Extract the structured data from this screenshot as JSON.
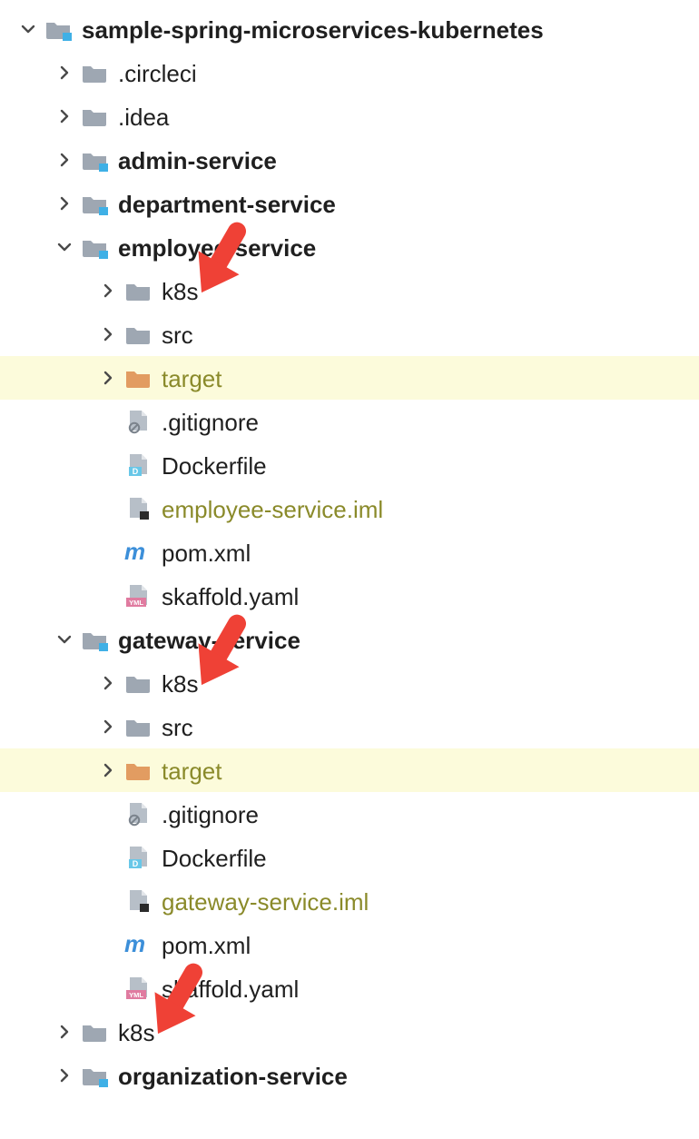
{
  "colors": {
    "folderGrey": "#9ea7b2",
    "folderOrange": "#e29c61",
    "cornerBlue": "#3fb0e6",
    "fileGrey": "#b7bfc8",
    "fileAccentD": "#68c7e8",
    "fileAccentYml": "#e07ba0",
    "mavenBlue": "#3c8fd9",
    "olive": "#8a8a2a",
    "hl": "#fcfbdb"
  },
  "rows": [
    {
      "level": 0,
      "toggle": "down",
      "icon": "module-folder",
      "label": "sample-spring-microservices-kubernetes",
      "bold": true,
      "olive": false,
      "hl": false
    },
    {
      "level": 1,
      "toggle": "right",
      "icon": "folder",
      "label": ".circleci",
      "bold": false,
      "olive": false,
      "hl": false
    },
    {
      "level": 1,
      "toggle": "right",
      "icon": "folder",
      "label": ".idea",
      "bold": false,
      "olive": false,
      "hl": false
    },
    {
      "level": 1,
      "toggle": "right",
      "icon": "module-folder",
      "label": "admin-service",
      "bold": true,
      "olive": false,
      "hl": false
    },
    {
      "level": 1,
      "toggle": "right",
      "icon": "module-folder",
      "label": "department-service",
      "bold": true,
      "olive": false,
      "hl": false
    },
    {
      "level": 1,
      "toggle": "down",
      "icon": "module-folder",
      "label": "employee-service",
      "bold": true,
      "olive": false,
      "hl": false,
      "arrow_to": true
    },
    {
      "level": 2,
      "toggle": "right",
      "icon": "folder",
      "label": "k8s",
      "bold": false,
      "olive": false,
      "hl": false
    },
    {
      "level": 2,
      "toggle": "right",
      "icon": "folder",
      "label": "src",
      "bold": false,
      "olive": false,
      "hl": false
    },
    {
      "level": 2,
      "toggle": "right",
      "icon": "folder-orange",
      "label": "target",
      "bold": false,
      "olive": true,
      "hl": true
    },
    {
      "level": 2,
      "toggle": "",
      "icon": "file-ignore",
      "label": ".gitignore",
      "bold": false,
      "olive": false,
      "hl": false
    },
    {
      "level": 2,
      "toggle": "",
      "icon": "file-d",
      "label": "Dockerfile",
      "bold": false,
      "olive": false,
      "hl": false
    },
    {
      "level": 2,
      "toggle": "",
      "icon": "file-iml",
      "label": "employee-service.iml",
      "bold": false,
      "olive": true,
      "hl": false
    },
    {
      "level": 2,
      "toggle": "",
      "icon": "maven",
      "label": "pom.xml",
      "bold": false,
      "olive": false,
      "hl": false
    },
    {
      "level": 2,
      "toggle": "",
      "icon": "file-yml",
      "label": "skaffold.yaml",
      "bold": false,
      "olive": false,
      "hl": false
    },
    {
      "level": 1,
      "toggle": "down",
      "icon": "module-folder",
      "label": "gateway-service",
      "bold": true,
      "olive": false,
      "hl": false,
      "arrow_to": true
    },
    {
      "level": 2,
      "toggle": "right",
      "icon": "folder",
      "label": "k8s",
      "bold": false,
      "olive": false,
      "hl": false
    },
    {
      "level": 2,
      "toggle": "right",
      "icon": "folder",
      "label": "src",
      "bold": false,
      "olive": false,
      "hl": false
    },
    {
      "level": 2,
      "toggle": "right",
      "icon": "folder-orange",
      "label": "target",
      "bold": false,
      "olive": true,
      "hl": true
    },
    {
      "level": 2,
      "toggle": "",
      "icon": "file-ignore",
      "label": ".gitignore",
      "bold": false,
      "olive": false,
      "hl": false
    },
    {
      "level": 2,
      "toggle": "",
      "icon": "file-d",
      "label": "Dockerfile",
      "bold": false,
      "olive": false,
      "hl": false
    },
    {
      "level": 2,
      "toggle": "",
      "icon": "file-iml",
      "label": "gateway-service.iml",
      "bold": false,
      "olive": true,
      "hl": false
    },
    {
      "level": 2,
      "toggle": "",
      "icon": "maven",
      "label": "pom.xml",
      "bold": false,
      "olive": false,
      "hl": false
    },
    {
      "level": 2,
      "toggle": "",
      "icon": "file-yml",
      "label": "skaffold.yaml",
      "bold": false,
      "olive": false,
      "hl": false,
      "arrow_below": true
    },
    {
      "level": 1,
      "toggle": "right",
      "icon": "folder",
      "label": "k8s",
      "bold": false,
      "olive": false,
      "hl": false
    },
    {
      "level": 1,
      "toggle": "right",
      "icon": "module-folder",
      "label": "organization-service",
      "bold": true,
      "olive": false,
      "hl": false
    }
  ],
  "arrows": [
    {
      "row": 6,
      "targetLevel": 2
    },
    {
      "row": 15,
      "targetLevel": 2
    },
    {
      "row": 23,
      "targetLevel": 1
    }
  ]
}
